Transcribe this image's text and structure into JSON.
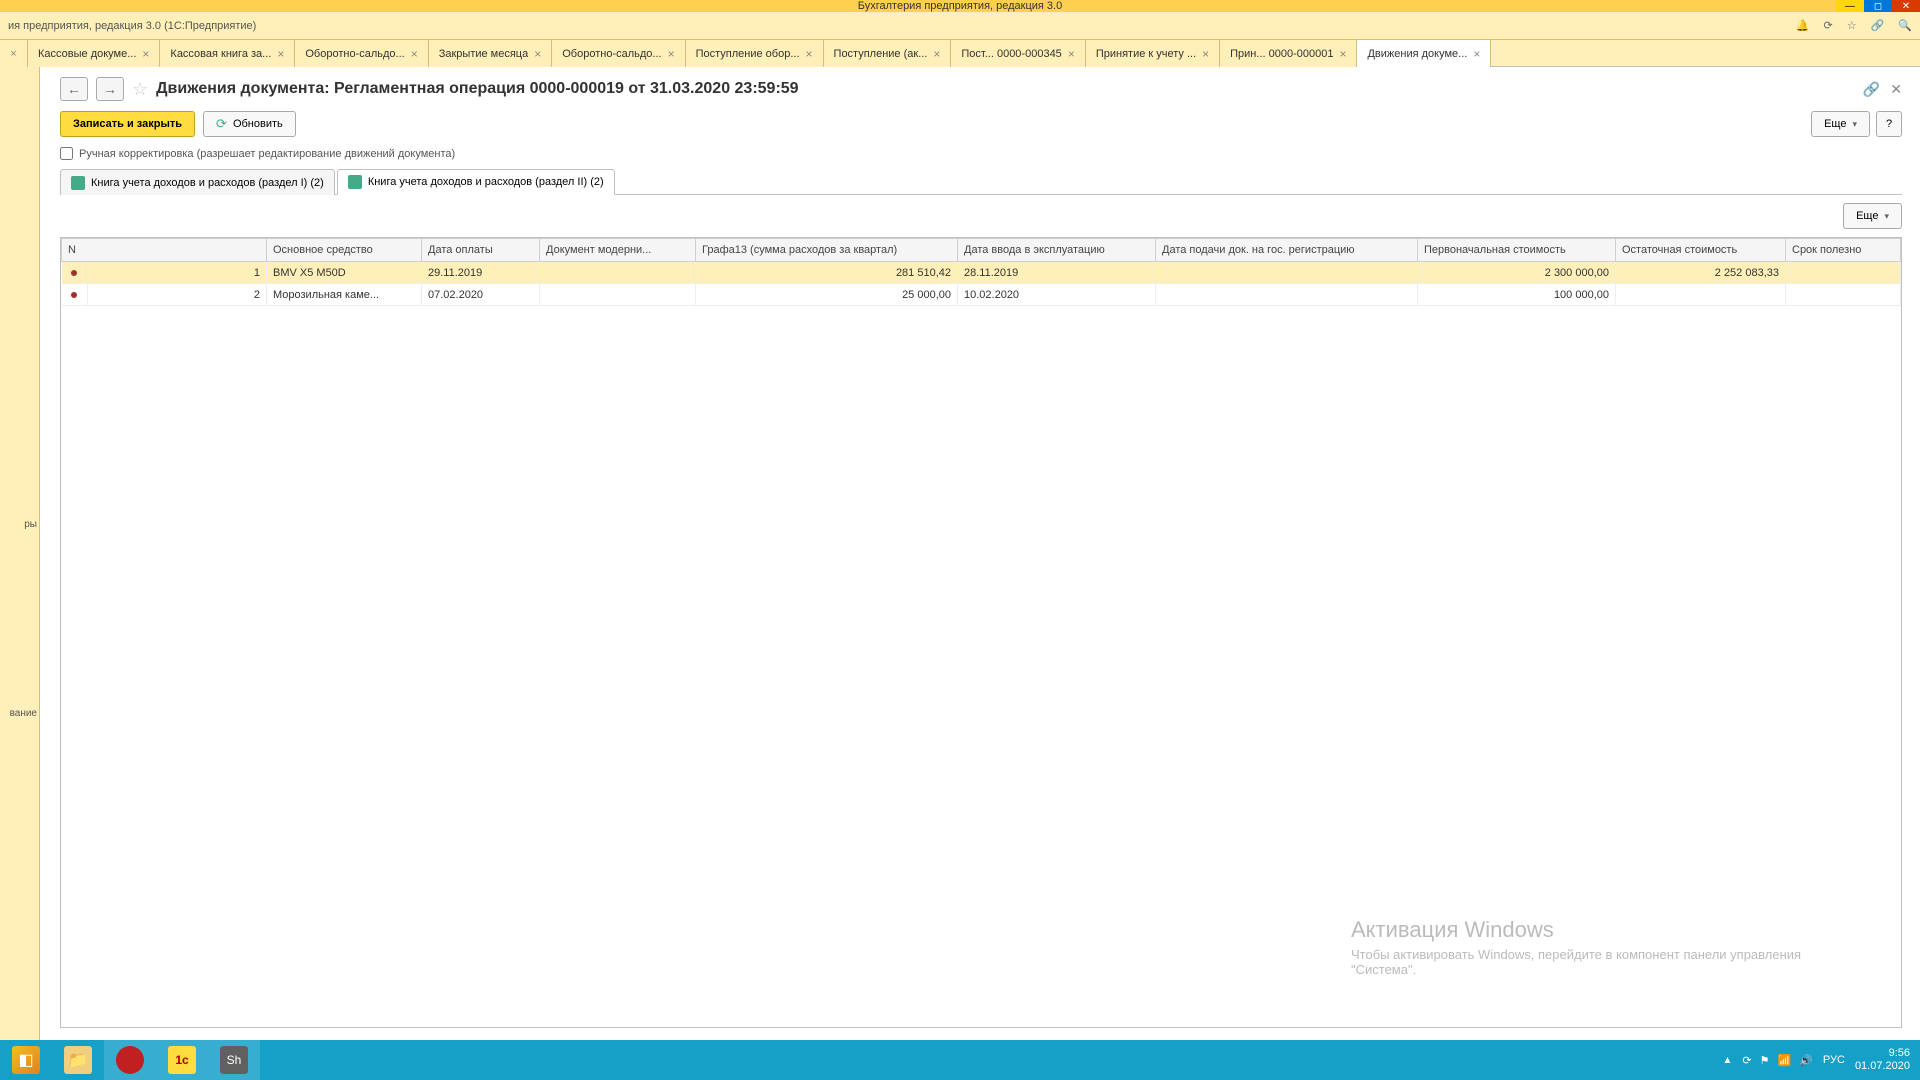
{
  "titlebar": {
    "title": "Бухгалтерия предприятия, редакция 3.0"
  },
  "subtitle": {
    "text": "ия предприятия, редакция 3.0  (1С:Предприятие)"
  },
  "tabs": [
    {
      "label": "Кассовые докуме..."
    },
    {
      "label": "Кассовая книга за..."
    },
    {
      "label": "Оборотно-сальдо..."
    },
    {
      "label": "Закрытие месяца"
    },
    {
      "label": "Оборотно-сальдо..."
    },
    {
      "label": "Поступление обор..."
    },
    {
      "label": "Поступление (ак..."
    },
    {
      "label": "Пост...  0000-000345"
    },
    {
      "label": "Принятие к учету ..."
    },
    {
      "label": "Прин...  0000-000001"
    },
    {
      "label": "Движения докуме..."
    }
  ],
  "sidebar": {
    "item1": "ры",
    "item2": "вание"
  },
  "doc": {
    "title": "Движения документа: Регламентная операция 0000-000019 от 31.03.2020 23:59:59"
  },
  "toolbar": {
    "write_close": "Записать и закрыть",
    "refresh": "Обновить",
    "more": "Еще",
    "help": "?"
  },
  "checkbox": {
    "label": "Ручная корректировка (разрешает редактирование движений документа)"
  },
  "inner_tabs": {
    "tab1": "Книга учета доходов и расходов (раздел I) (2)",
    "tab2": "Книга учета доходов и расходов (раздел II) (2)"
  },
  "grid": {
    "more": "Еще",
    "headers": {
      "n": "N",
      "asset": "Основное средство",
      "pay_date": "Дата оплаты",
      "doc_mod": "Документ модерни...",
      "graph13": "Графа13 (сумма расходов за квартал)",
      "commiss_date": "Дата ввода в эксплуатацию",
      "reg_date": "Дата подачи док. на гос. регистрацию",
      "init_cost": "Первоначальная стоимость",
      "rem_cost": "Остаточная стоимость",
      "term": "Срок полезно"
    },
    "rows": [
      {
        "n": "1",
        "asset": "BMV X5 M50D",
        "pay_date": "29.11.2019",
        "doc_mod": "",
        "graph13": "281 510,42",
        "commiss_date": "28.11.2019",
        "reg_date": "",
        "init_cost": "2 300 000,00",
        "rem_cost": "2 252 083,33",
        "term": ""
      },
      {
        "n": "2",
        "asset": "Морозильная каме...",
        "pay_date": "07.02.2020",
        "doc_mod": "",
        "graph13": "25 000,00",
        "commiss_date": "10.02.2020",
        "reg_date": "",
        "init_cost": "100 000,00",
        "rem_cost": "",
        "term": ""
      }
    ]
  },
  "watermark": {
    "title": "Активация Windows",
    "text": "Чтобы активировать Windows, перейдите в компонент панели управления \"Система\"."
  },
  "tray": {
    "lang": "РУС",
    "time": "9:56",
    "date": "01.07.2020"
  }
}
